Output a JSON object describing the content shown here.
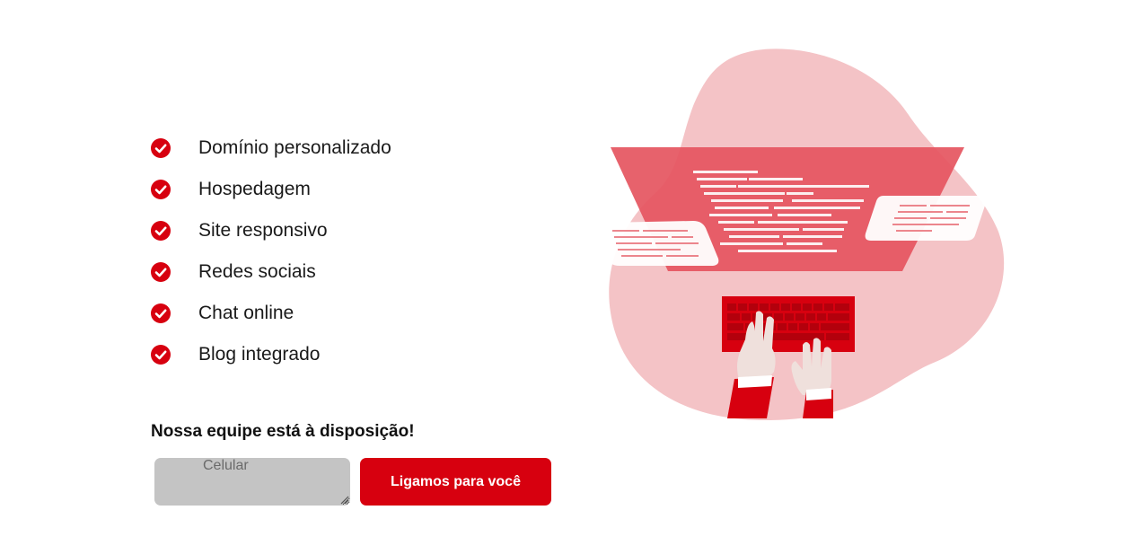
{
  "features": {
    "icon": "check-circle-icon",
    "icon_color": "#d7000f",
    "items": [
      {
        "label": "Domínio personalizado"
      },
      {
        "label": "Hospedagem"
      },
      {
        "label": "Site responsivo"
      },
      {
        "label": "Redes sociais"
      },
      {
        "label": "Chat online"
      },
      {
        "label": "Blog integrado"
      }
    ]
  },
  "cta": {
    "title": "Nossa equipe está à disposição!",
    "phone_placeholder": "Celular",
    "phone_value": "",
    "button_label": "Ligamos para você"
  },
  "colors": {
    "accent": "#d7000f",
    "blob": "#f4c3c6",
    "screen": "#e5555f",
    "input_bg": "#c4c4c4"
  },
  "illustration": {
    "icon": "developer-typing-illustration"
  }
}
